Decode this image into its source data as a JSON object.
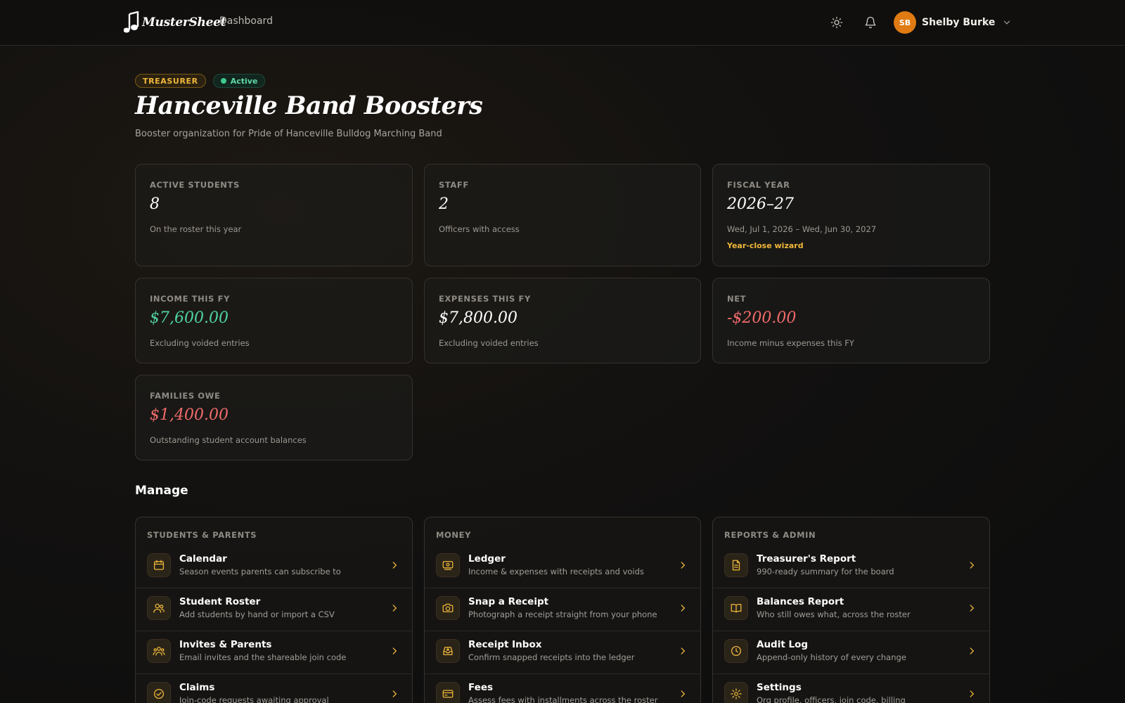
{
  "header": {
    "logo_text": "MusterSheet",
    "nav_dashboard": "Dashboard",
    "user": {
      "initials": "SB",
      "name": "Shelby Burke"
    },
    "icons": [
      "sun-icon",
      "bell-icon",
      "chevron-down-icon"
    ]
  },
  "hero": {
    "role_badge": "TREASURER",
    "status_badge": "Active",
    "title": "Hanceville Band Boosters",
    "subtitle": "Booster organization for Pride of Hanceville Bulldog Marching Band"
  },
  "stats": {
    "active_students": {
      "label": "ACTIVE STUDENTS",
      "value": "8",
      "note": "On the roster this year"
    },
    "staff": {
      "label": "STAFF",
      "value": "2",
      "note": "Officers with access"
    },
    "fiscal_year": {
      "label": "FISCAL YEAR",
      "value": "2026–27",
      "note": "Wed, Jul 1, 2026 – Wed, Jun 30, 2027",
      "link": "Year-close wizard"
    },
    "income": {
      "label": "INCOME THIS FY",
      "value": "$7,600.00",
      "note": "Excluding voided entries"
    },
    "expenses": {
      "label": "EXPENSES THIS FY",
      "value": "$7,800.00",
      "note": "Excluding voided entries"
    },
    "net": {
      "label": "NET",
      "value": "-$200.00",
      "note": "Income minus expenses this FY"
    },
    "families_owe": {
      "label": "FAMILIES OWE",
      "value": "$1,400.00",
      "note": "Outstanding student account balances"
    }
  },
  "manage": {
    "title": "Manage",
    "students": {
      "heading": "STUDENTS & PARENTS",
      "items": [
        {
          "title": "Calendar",
          "desc": "Season events parents can subscribe to",
          "icon": "calendar-icon"
        },
        {
          "title": "Student Roster",
          "desc": "Add students by hand or import a CSV",
          "icon": "users-icon"
        },
        {
          "title": "Invites & Parents",
          "desc": "Email invites and the shareable join code",
          "icon": "group-icon"
        },
        {
          "title": "Claims",
          "desc": "Join-code requests awaiting approval",
          "icon": "check-circle-icon"
        }
      ]
    },
    "money": {
      "heading": "MONEY",
      "items": [
        {
          "title": "Ledger",
          "desc": "Income & expenses with receipts and voids",
          "icon": "ledger-icon"
        },
        {
          "title": "Snap a Receipt",
          "desc": "Photograph a receipt straight from your phone",
          "icon": "camera-icon"
        },
        {
          "title": "Receipt Inbox",
          "desc": "Confirm snapped receipts into the ledger",
          "icon": "inbox-icon"
        },
        {
          "title": "Fees",
          "desc": "Assess fees with installments across the roster",
          "icon": "credit-card-icon"
        }
      ]
    },
    "reports": {
      "heading": "REPORTS & ADMIN",
      "items": [
        {
          "title": "Treasurer's Report",
          "desc": "990-ready summary for the board",
          "icon": "document-icon"
        },
        {
          "title": "Balances Report",
          "desc": "Who still owes what, across the roster",
          "icon": "book-icon"
        },
        {
          "title": "Audit Log",
          "desc": "Append-only history of every change",
          "icon": "clock-icon"
        },
        {
          "title": "Settings",
          "desc": "Org profile, officers, join code, billing",
          "icon": "gear-icon"
        }
      ]
    }
  },
  "colors": {
    "accent": "#f0b73a",
    "positive": "#4fd3a0",
    "negative": "#f06b6b",
    "avatar": "#e07a12"
  }
}
